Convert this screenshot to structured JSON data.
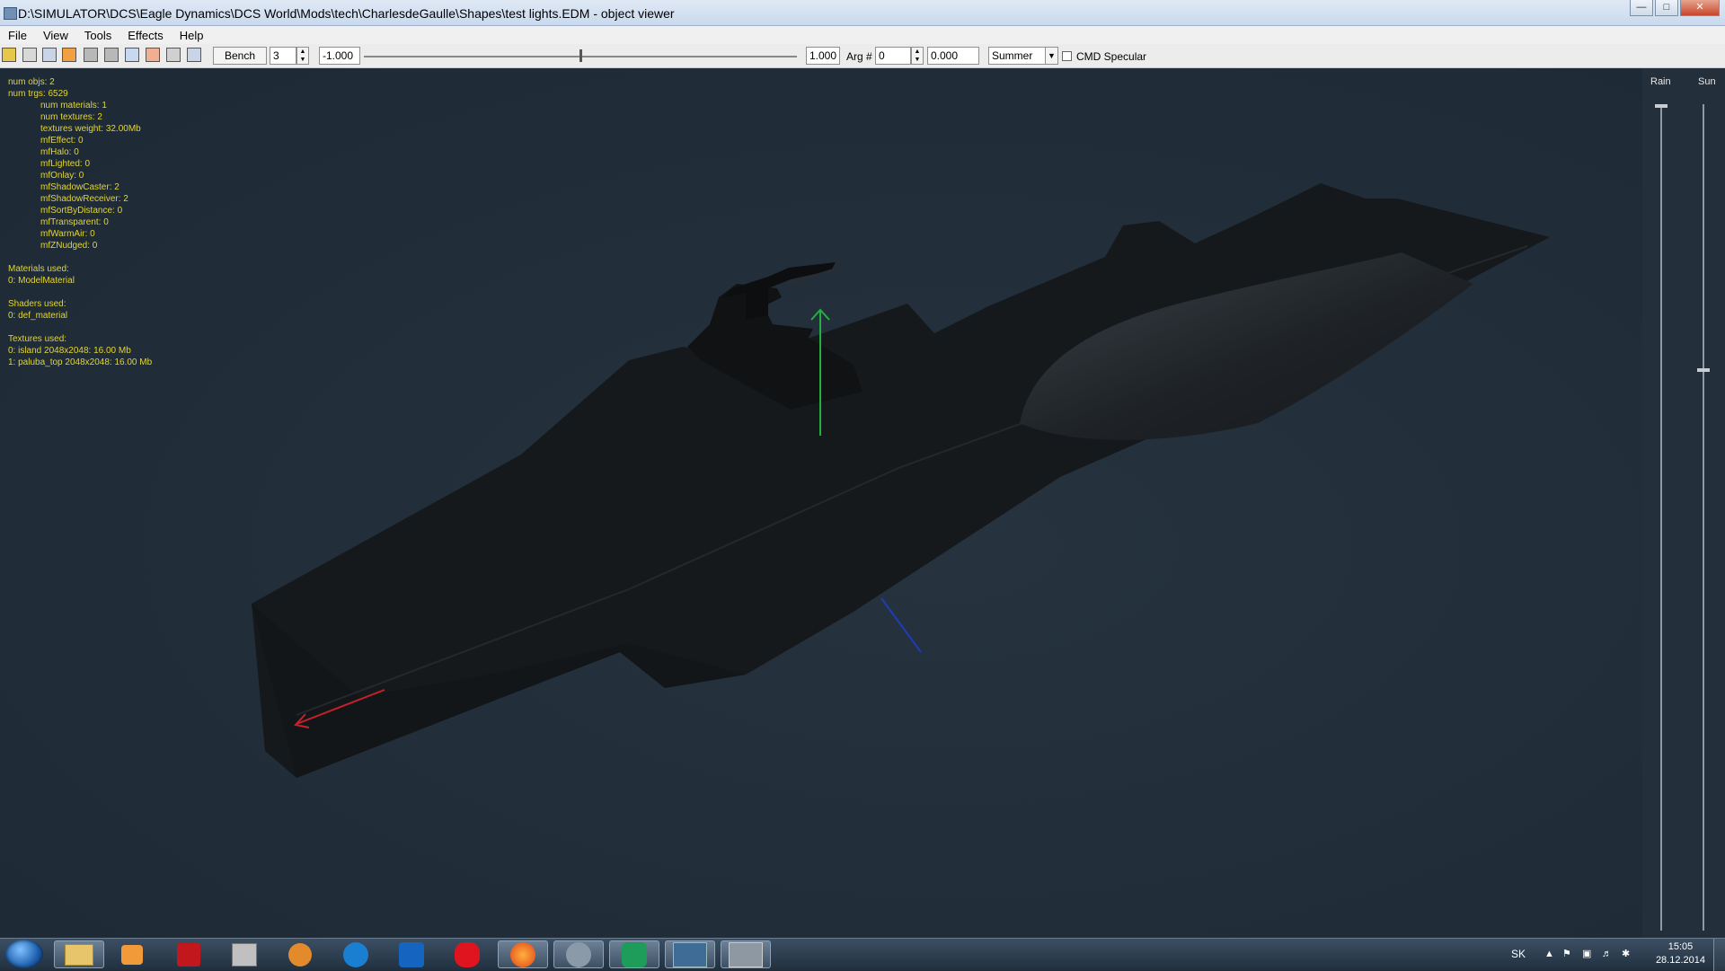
{
  "window": {
    "title": "D:\\SIMULATOR\\DCS\\Eagle Dynamics\\DCS World\\Mods\\tech\\CharlesdeGaulle\\Shapes\\test lights.EDM - object viewer"
  },
  "menu": [
    "File",
    "View",
    "Tools",
    "Effects",
    "Help"
  ],
  "toolbar": {
    "bench_label": "Bench",
    "bench_value": "3",
    "slider_min": "-1.000",
    "slider_max": "1.000",
    "arg_label": "Arg #",
    "arg_value": "0",
    "arg_amount": "0.000",
    "season": "Summer",
    "cmd_specular_label": "CMD Specular"
  },
  "stats": {
    "num_objs": "num objs: 2",
    "num_trgs": "num trgs: 6529",
    "num_materials": "num materials: 1",
    "num_textures": "num textures: 2",
    "textures_weight": "textures weight: 32.00Mb",
    "mfEffect": "mfEffect: 0",
    "mfHalo": "mfHalo: 0",
    "mfLighted": "mfLighted: 0",
    "mfOnlay": "mfOnlay: 0",
    "mfShadowCaster": "mfShadowCaster: 2",
    "mfShadowReceiver": "mfShadowReceiver: 2",
    "mfSortByDistance": "mfSortByDistance: 0",
    "mfTransparent": "mfTransparent: 0",
    "mfWarmAir": "mfWarmAir: 0",
    "mfZNudged": "mfZNudged: 0",
    "materials_heading": "Materials used:",
    "material_0": "0: ModelMaterial",
    "shaders_heading": "Shaders used:",
    "shader_0": "0: def_material",
    "textures_heading": "Textures used:",
    "texture_0": "0: island 2048x2048: 16.00 Mb",
    "texture_1": "1: paluba_top 2048x2048: 16.00 Mb"
  },
  "right_panel": {
    "rain_label": "Rain",
    "sun_label": "Sun",
    "rain_level": 0.0,
    "sun_level": 0.32
  },
  "taskbar": {
    "language": "SK",
    "time": "15:05",
    "date": "28.12.2014",
    "apps": [
      "windows-explorer",
      "media-player",
      "acrobat-reader",
      "99-app",
      "blender",
      "fan-app",
      "notepad-app",
      "paint-splash",
      "firefox",
      "dcs-app",
      "coreldraw",
      "dcs-world",
      "dcs-world-2"
    ]
  },
  "colors": {
    "viewport_bg": "#222f3c",
    "stats_text": "#e2d535",
    "axis_x": "#c8202a",
    "axis_y": "#22b040",
    "axis_z": "#1d3cb8"
  }
}
